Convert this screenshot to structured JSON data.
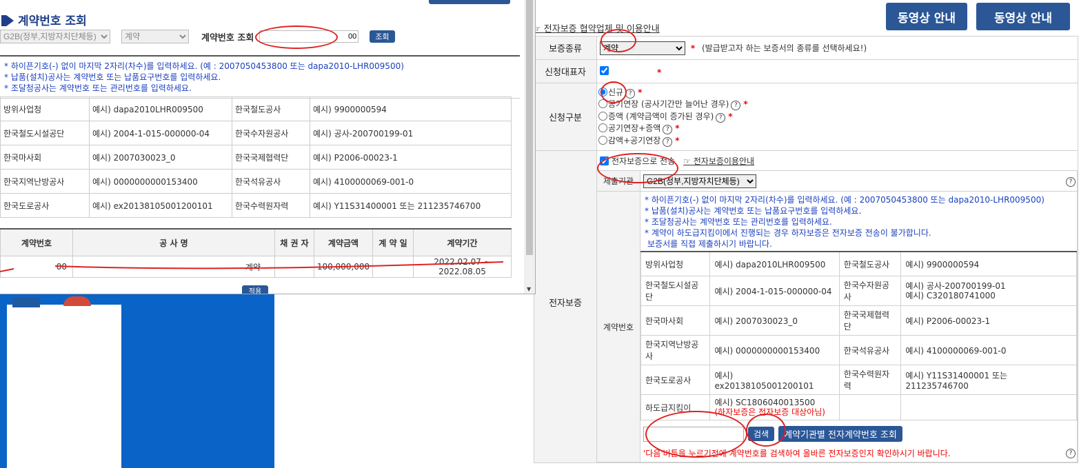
{
  "bg": {
    "video_btn_1": "동영상 안내",
    "video_btn_2": "동영상 안내",
    "guide_link": "전자보증 협약업체 및 이용안내",
    "rows": {
      "guarantee_type_label": "보증종류",
      "guarantee_type_value": "계약",
      "guarantee_type_hint": "(발급받고자 하는 보증서의 종류를 선택하세요!)",
      "applicant_rep_label": "신청대표자",
      "apply_type_label": "신청구분",
      "apply_options": [
        "신규",
        "공기연장 (공사기간만 늘어난 경우)",
        "증액 (계약금액이 증가된 경우)",
        "공기연장+증액",
        "감액+공기연장"
      ],
      "egt_label": "전자보증",
      "egt_check_label": "전자보증으로 전송",
      "egt_info_link": "전자보증이용안내",
      "submit_org_label": "제출기관",
      "submit_org_value": "G2B(정부,지방자치단체등)",
      "contract_no_label": "계약번호"
    },
    "notes": [
      "* 하이픈기호(-) 없이 마지막 2자리(차수)를 입력하세요. (예 : 2007050453800 또는 dapa2010-LHR009500)",
      "* 납품(설치)공사는 계약번호 또는 납품요구번호를 입력하세요.",
      "* 조달청공사는 계약번호 또는 관리번호를 입력하세요.",
      "* 계약이 하도급지킴이에서 진행되는 경우 하자보증은 전자보증 전송이 불가합니다.",
      "보증서를 직접 제출하시기 바랍니다."
    ],
    "examples": [
      [
        "방위사업청",
        "예시) dapa2010LHR009500",
        "한국철도공사",
        "예시) 9900000594"
      ],
      [
        "한국철도시설공단",
        "예시) 2004-1-015-000000-04",
        "한국수자원공사",
        "예시) 공사-200700199-01\n예시) C320180741000"
      ],
      [
        "한국마사회",
        "예시) 2007030023_0",
        "한국국제협력단",
        "예시) P2006-00023-1"
      ],
      [
        "한국지역난방공사",
        "예시) 0000000000153400",
        "한국석유공사",
        "예시) 4100000069-001-0"
      ],
      [
        "한국도로공사",
        "예시) ex20138105001200101",
        "한국수력원자력",
        "예시) Y11S31400001 또는 211235746700"
      ],
      [
        "하도급지킴이",
        "예시) SC1806040013500",
        "",
        ""
      ]
    ],
    "subcontract_note": "(하자보증은 전자보증 대상아님)",
    "search_btn": "검색",
    "org_search_btn": "계약기관별 전자계약번호 조회",
    "bottom_warning": "'다음'버튼을 누르기전에 계약번호를 검색하여 올바른 전자보증인지 확인하시기 바랍니다."
  },
  "popup": {
    "title": "계약번호 조회",
    "org_select": "G2B(정부,지방자치단체등)",
    "type_select": "계약",
    "search_label": "계약번호 조회",
    "search_value": "00",
    "search_btn": "조회",
    "notes": [
      "* 하이픈기호(-) 없이 마지막 2자리(차수)를 입력하세요. (예 : 2007050453800 또는 dapa2010-LHR009500)",
      "* 납품(설치)공사는 계약번호 또는 납품요구번호를 입력하세요.",
      "* 조달청공사는 계약번호 또는 관리번호를 입력하세요."
    ],
    "examples": [
      [
        "방위사업청",
        "예시) dapa2010LHR009500",
        "한국철도공사",
        "예시) 9900000594"
      ],
      [
        "한국철도시설공단",
        "예시) 2004-1-015-000000-04",
        "한국수자원공사",
        "예시) 공사-200700199-01"
      ],
      [
        "한국마사회",
        "예시) 2007030023_0",
        "한국국제협력단",
        "예시) P2006-00023-1"
      ],
      [
        "한국지역난방공사",
        "예시) 0000000000153400",
        "한국석유공사",
        "예시) 4100000069-001-0"
      ],
      [
        "한국도로공사",
        "예시) ex20138105001200101",
        "한국수력원자력",
        "예시) Y11S31400001 또는 211235746700"
      ]
    ],
    "result_headers": [
      "계약번호",
      "공 사 명",
      "채 권 자",
      "계약금액",
      "계 약 일",
      "계약기간"
    ],
    "result_row": [
      "00",
      "계약",
      "",
      "100,000,000",
      "",
      "2022.02.07 ~ 2022.08.05"
    ],
    "apply_btn": "적용"
  },
  "colors": {
    "accent": "#2b5797",
    "annotation": "#e02020",
    "note_text": "#1a3fbf",
    "desktop": "#0a64c8"
  }
}
